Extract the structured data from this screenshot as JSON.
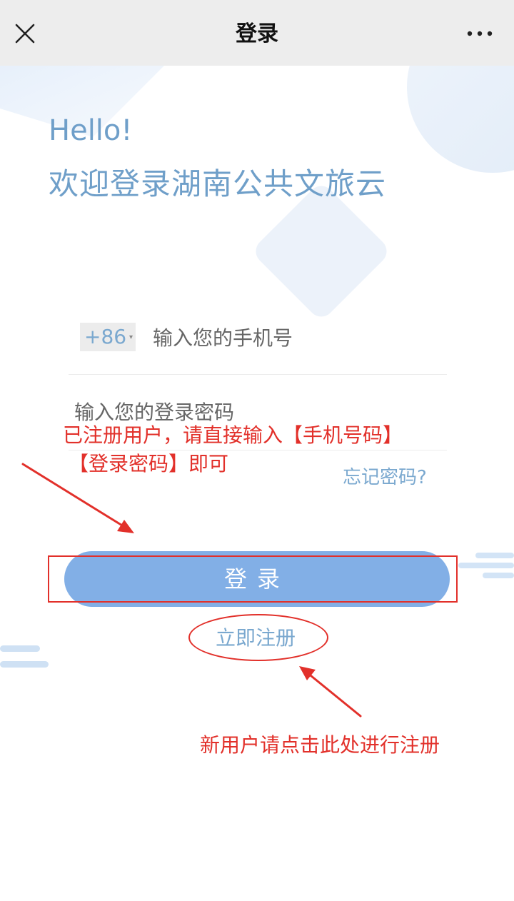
{
  "header": {
    "title": "登录",
    "close_icon": "close-icon",
    "more_icon": "more-icon"
  },
  "greeting": {
    "hello": "Hello!",
    "welcome": "欢迎登录湖南公共文旅云"
  },
  "form": {
    "country_code": "+86",
    "phone_placeholder": "输入您的手机号",
    "password_placeholder": "输入您的登录密码",
    "forgot_link": "忘记密码?",
    "login_button": "登录",
    "register_link": "立即注册"
  },
  "annotations": {
    "note_login_line1": "已注册用户，请直接输入【手机号码】",
    "note_login_line2": "【登录密码】即可",
    "note_register": "新用户请点击此处进行注册",
    "color": "#e2302a"
  },
  "colors": {
    "accent": "#7aa8cf",
    "button": "#82afe6",
    "header_bg": "#ededed"
  }
}
